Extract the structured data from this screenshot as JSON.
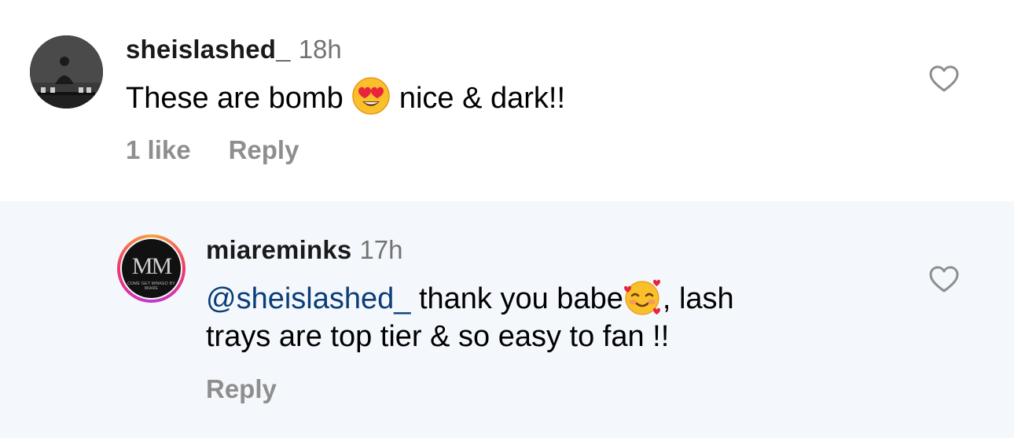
{
  "comments": [
    {
      "username": "sheislashed_",
      "time": "18h",
      "text_before": "These are bomb ",
      "emoji": "heart-eyes",
      "text_after": "  nice & dark!!",
      "likes": "1 like",
      "reply": "Reply"
    },
    {
      "username": "miareminks",
      "time": "17h",
      "mention": "@sheislashed_",
      "text_before": " thank you babe",
      "emoji": "smiling-face-with-hearts",
      "line1_after": ", lash",
      "line2": "trays are top tier & so easy to fan !!",
      "reply": "Reply",
      "avatar_logo": "MM",
      "avatar_tagline": "COME GET MINKED BY MIARE"
    }
  ],
  "colors": {
    "reply_bg": "#f4f8fc",
    "mention": "#0b3d78",
    "muted": "#8e8e8e",
    "time": "#737373"
  }
}
